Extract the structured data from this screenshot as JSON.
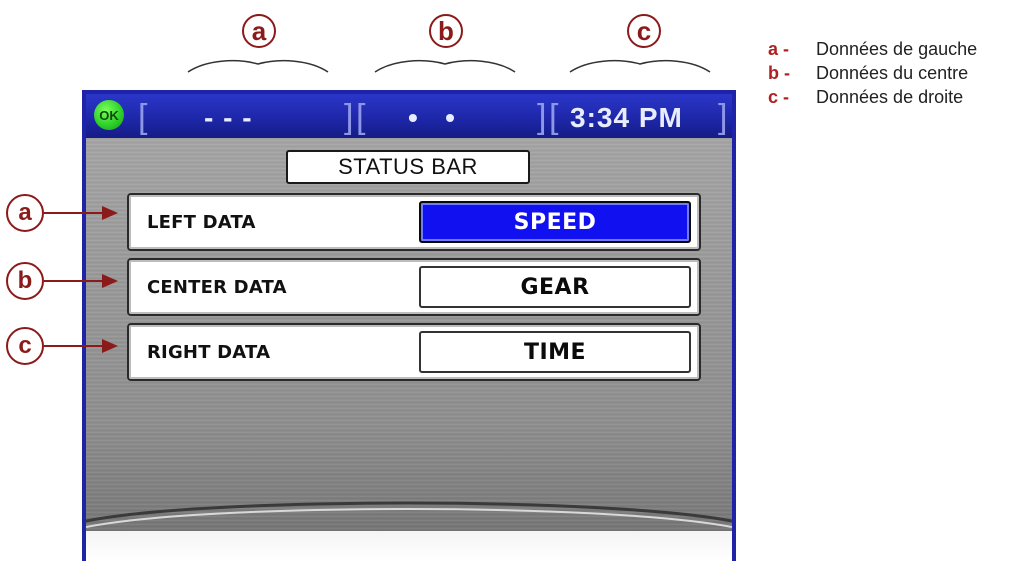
{
  "callouts": {
    "a": "a",
    "b": "b",
    "c": "c"
  },
  "legend": {
    "items": [
      {
        "key": "a -",
        "text": "Données de gauche"
      },
      {
        "key": "b -",
        "text": "Données du centre"
      },
      {
        "key": "c -",
        "text": "Données de droite"
      }
    ]
  },
  "status_bar": {
    "ok_badge": "OK",
    "left_value": "- - -",
    "center_value": "•   •",
    "right_value": "3:34 PM",
    "bracket_open": "[",
    "bracket_close": "]"
  },
  "screen": {
    "title": "STATUS BAR",
    "rows": [
      {
        "label": "LEFT DATA",
        "value": "SPEED",
        "selected": true
      },
      {
        "label": "CENTER DATA",
        "value": "GEAR",
        "selected": false
      },
      {
        "label": "RIGHT DATA",
        "value": "TIME",
        "selected": false
      }
    ]
  },
  "colors": {
    "callout": "#8b1a1a",
    "legend_key": "#b02020",
    "status_bar": "#1d26a6",
    "ok_badge": "#2fd12a",
    "selected_value": "#1010f0",
    "screen_frame": "#1e23a8"
  }
}
